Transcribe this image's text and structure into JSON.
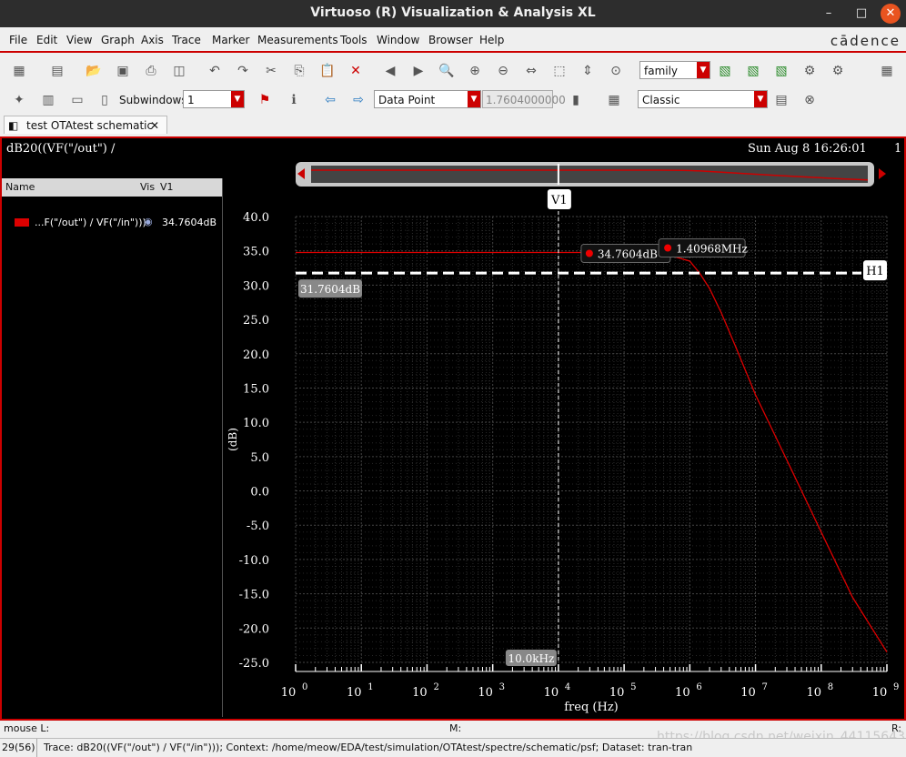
{
  "window": {
    "title": "Virtuoso (R) Visualization & Analysis XL",
    "minimize": "–",
    "maximize": "□",
    "close": "✕"
  },
  "menu": {
    "items": [
      "File",
      "Edit",
      "View",
      "Graph",
      "Axis",
      "Trace",
      "Marker",
      "Measurements",
      "Tools",
      "Window",
      "Browser",
      "Help"
    ],
    "brand": "cādence"
  },
  "toolbar": {
    "family_combo": "family",
    "subwindows_label": "Subwindows:",
    "subwindows_value": "1",
    "datapoint_combo": "Data Point",
    "datapoint_value": "1.7604000000",
    "style_combo": "Classic"
  },
  "tab": {
    "label": "test OTAtest schematic",
    "close": "✕"
  },
  "plot": {
    "expression": "dB20((VF(\"/out\") /",
    "timestamp": "Sun Aug  8 16:26:01",
    "subwindow_number": "1",
    "panel": {
      "col_name": "Name",
      "col_vis": "Vis",
      "col_v1": "V1",
      "trace_name": "...F(\"/out\") / VF(\"/in\")))",
      "trace_v1": "34.7604dB",
      "trace_color": "#dd0000"
    },
    "markers": {
      "v1_label": "V1",
      "h1_label": "H1",
      "h1_value": "31.7604dB",
      "v1_x_label": "10.0kHz",
      "point_label": "34.7604dB",
      "intersect_label": "1.40968MHz"
    }
  },
  "chart_data": {
    "type": "line",
    "xscale": "log",
    "xlabel": "freq (Hz)",
    "ylabel": "(dB)",
    "xlim": [
      1,
      1000000000
    ],
    "ylim": [
      -25,
      40
    ],
    "x_ticks": [
      "10",
      "10",
      "10",
      "10",
      "10",
      "10",
      "10",
      "10",
      "10",
      "10"
    ],
    "x_tick_exponents": [
      "0",
      "1",
      "2",
      "3",
      "4",
      "5",
      "6",
      "7",
      "8",
      "9"
    ],
    "y_ticks": [
      "40.0",
      "35.0",
      "30.0",
      "25.0",
      "20.0",
      "15.0",
      "10.0",
      "5.0",
      "0.0",
      "-5.0",
      "-10.0",
      "-15.0",
      "-20.0",
      "-25.0"
    ],
    "grid": true,
    "series": [
      {
        "x": [
          1,
          10,
          100,
          1000,
          10000,
          100000,
          400000,
          1000000,
          1409680,
          2000000,
          3000000,
          5000000,
          10000000,
          30000000,
          100000000,
          300000000,
          1000000000
        ],
        "y": [
          34.76,
          34.76,
          34.76,
          34.76,
          34.76,
          34.76,
          34.6,
          33.5,
          31.76,
          29.5,
          26.0,
          21.0,
          14.0,
          4.5,
          -6.0,
          -15.5,
          -23.5
        ]
      }
    ],
    "v1_x": 10000,
    "h1_y": 31.7604,
    "colors": {
      "trace": "#dd0000",
      "grid": "#444444",
      "axis": "#ffffff"
    }
  },
  "status": {
    "mouse_l": "mouse L:",
    "mouse_m": "M:",
    "mouse_r": "R:",
    "counter": "29(56)",
    "message": "Trace: dB20((VF(\"/out\") / VF(\"/in\"))); Context: /home/meow/EDA/test/simulation/OTAtest/spectre/schematic/psf; Dataset: tran-tran",
    "watermark": "https://blog.csdn.net/weixin_44115643"
  }
}
